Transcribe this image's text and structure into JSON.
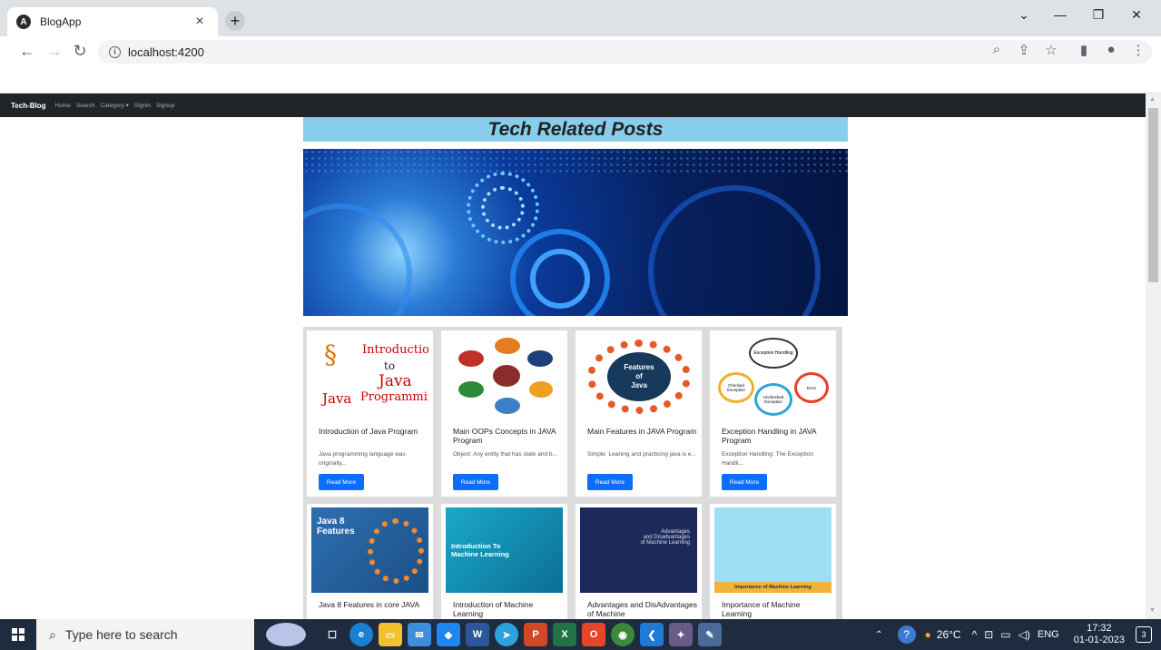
{
  "browser": {
    "tab_title": "BlogApp",
    "tab_close": "×",
    "new_tab": "+",
    "url": "localhost:4200",
    "window_controls": [
      "⌄",
      "—",
      "❐",
      "✕"
    ]
  },
  "app_nav": {
    "brand": "Tech-Blog",
    "links": [
      "Home",
      "Search",
      "Category ▾",
      "Signin",
      "Signup"
    ]
  },
  "page": {
    "heading": "Tech Related Posts",
    "read_more_label": "Read More",
    "cards": [
      {
        "title": "Introduction of Java Program",
        "excerpt": "Java programming language was originally...",
        "image_text": [
          "Introduction",
          "to",
          "Java",
          "Programming"
        ],
        "icon": "java-logo-image"
      },
      {
        "title": "Main OOPs Concepts in JAVA Program",
        "excerpt": "Object: Any entity that has state and b...",
        "icon": "oops-concepts-image"
      },
      {
        "title": "Main Features in JAVA Program",
        "excerpt": "Simple: Leaning and practicing java is e...",
        "image_text": [
          "Features",
          "of",
          "Java"
        ],
        "icon": "java-features-image"
      },
      {
        "title": "Exception Handling in JAVA Program",
        "excerpt": "Exception Handling: The Exception Handli...",
        "image_text": [
          "Exception Handling",
          "Checked Exception",
          "Unchecked Exception",
          "Error"
        ],
        "icon": "exception-handling-image"
      },
      {
        "title": "Java 8 Features in core JAVA",
        "image_text": [
          "Java 8",
          "Features"
        ],
        "icon": "java8-features-image"
      },
      {
        "title": "Introduction of Machine Learning",
        "image_text": [
          "Introduction To",
          "Machine Learning"
        ],
        "icon": "machine-learning-image"
      },
      {
        "title": "Advantages and DisAdvantages of Machine",
        "image_text": [
          "Advantages",
          "and Disadvantages",
          "of Machine Learning"
        ],
        "icon": "ml-advantages-image"
      },
      {
        "title": "Importance of Machine Learning",
        "image_text": [
          "Importance of Machine Learning"
        ],
        "icon": "ml-importance-image"
      }
    ]
  },
  "taskbar": {
    "search_placeholder": "Type here to search",
    "weather": "26°C",
    "language": "ENG",
    "time": "17:32",
    "date": "01-01-2023",
    "notification_count": "3"
  }
}
